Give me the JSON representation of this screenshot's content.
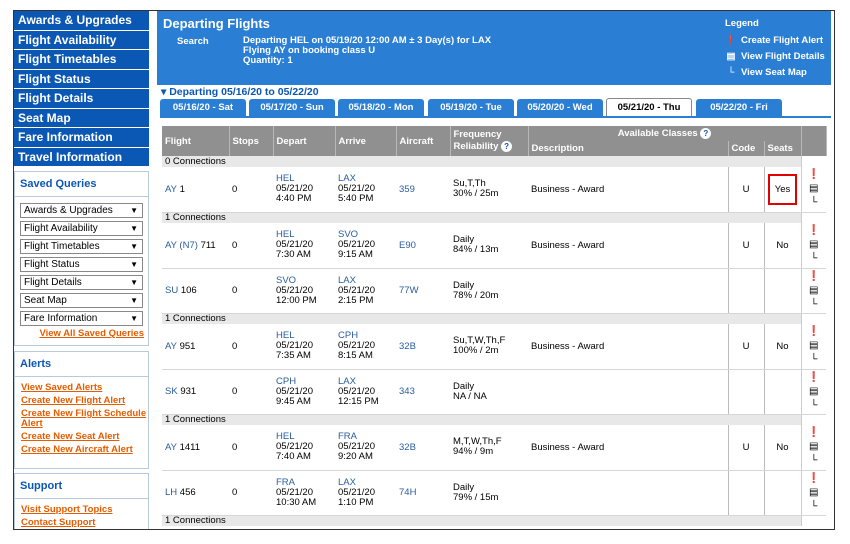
{
  "nav": [
    "Awards & Upgrades",
    "Flight Availability",
    "Flight Timetables",
    "Flight Status",
    "Flight Details",
    "Seat Map",
    "Fare Information",
    "Travel Information"
  ],
  "saved_queries": {
    "title": "Saved Queries",
    "selects": [
      "Awards & Upgrades",
      "Flight Availability",
      "Flight Timetables",
      "Flight Status",
      "Flight Details",
      "Seat Map",
      "Fare Information"
    ],
    "view_all": "View All Saved Queries"
  },
  "alerts": {
    "title": "Alerts",
    "links": [
      "View Saved Alerts",
      "Create New Flight Alert",
      "Create New Flight Schedule Alert",
      "Create New Seat Alert",
      "Create New Aircraft Alert"
    ]
  },
  "support": {
    "title": "Support",
    "links": [
      "Visit Support Topics",
      "Contact Support"
    ]
  },
  "header": {
    "title": "Departing Flights",
    "search_label": "Search",
    "search_lines": [
      "Departing HEL on 05/19/20 12:00 AM ± 3 Day(s) for LAX",
      "Flying AY on booking class U",
      "Quantity: 1"
    ]
  },
  "legend": {
    "title": "Legend",
    "items": [
      "Create Flight Alert",
      "View Flight Details",
      "View Seat Map"
    ]
  },
  "range": "Departing 05/16/20 to 05/22/20",
  "tabs": [
    "05/16/20 - Sat",
    "05/17/20 - Sun",
    "05/18/20 - Mon",
    "05/19/20 - Tue",
    "05/20/20 - Wed",
    "05/21/20 - Thu",
    "05/22/20 - Fri"
  ],
  "active_tab": "05/21/20 - Thu",
  "columns": {
    "flight": "Flight",
    "stops": "Stops",
    "depart": "Depart",
    "arrive": "Arrive",
    "aircraft": "Aircraft",
    "frequency": "Frequency",
    "reliability": "Reliability",
    "available_classes": "Available Classes",
    "description": "Description",
    "code": "Code",
    "seats": "Seats"
  },
  "groups": [
    {
      "label": "0 Connections",
      "flights": [
        {
          "carrier": "AY",
          "carrier_note": "",
          "number": "1",
          "stops": "0",
          "dep_ap": "HEL",
          "dep_date": "05/21/20",
          "dep_time": "4:40 PM",
          "arr_ap": "LAX",
          "arr_date": "05/21/20",
          "arr_time": "5:40 PM",
          "aircraft": "359",
          "freq": "Su,T,Th",
          "rel": "30% / 25m",
          "desc": "Business - Award",
          "code": "U",
          "seats": "Yes",
          "highlight": true
        }
      ]
    },
    {
      "label": "1 Connections",
      "flights": [
        {
          "carrier": "AY",
          "carrier_note": " (N7)",
          "number": "711",
          "stops": "0",
          "dep_ap": "HEL",
          "dep_date": "05/21/20",
          "dep_time": "7:30 AM",
          "arr_ap": "SVO",
          "arr_date": "05/21/20",
          "arr_time": "9:15 AM",
          "aircraft": "E90",
          "freq": "Daily",
          "rel": "84% / 13m",
          "desc": "Business - Award",
          "code": "U",
          "seats": "No",
          "highlight": false
        },
        {
          "carrier": "SU",
          "carrier_note": "",
          "number": "106",
          "stops": "0",
          "dep_ap": "SVO",
          "dep_date": "05/21/20",
          "dep_time": "12:00 PM",
          "arr_ap": "LAX",
          "arr_date": "05/21/20",
          "arr_time": "2:15 PM",
          "aircraft": "77W",
          "freq": "Daily",
          "rel": "78% / 20m",
          "desc": "",
          "code": "",
          "seats": "",
          "highlight": false
        }
      ]
    },
    {
      "label": "1 Connections",
      "flights": [
        {
          "carrier": "AY",
          "carrier_note": "",
          "number": "951",
          "stops": "0",
          "dep_ap": "HEL",
          "dep_date": "05/21/20",
          "dep_time": "7:35 AM",
          "arr_ap": "CPH",
          "arr_date": "05/21/20",
          "arr_time": "8:15 AM",
          "aircraft": "32B",
          "freq": "Su,T,W,Th,F",
          "rel": "100% / 2m",
          "desc": "Business - Award",
          "code": "U",
          "seats": "No",
          "highlight": false
        },
        {
          "carrier": "SK",
          "carrier_note": "",
          "number": "931",
          "stops": "0",
          "dep_ap": "CPH",
          "dep_date": "05/21/20",
          "dep_time": "9:45 AM",
          "arr_ap": "LAX",
          "arr_date": "05/21/20",
          "arr_time": "12:15 PM",
          "aircraft": "343",
          "freq": "Daily",
          "rel": "NA / NA",
          "desc": "",
          "code": "",
          "seats": "",
          "highlight": false
        }
      ]
    },
    {
      "label": "1 Connections",
      "flights": [
        {
          "carrier": "AY",
          "carrier_note": "",
          "number": "1411",
          "stops": "0",
          "dep_ap": "HEL",
          "dep_date": "05/21/20",
          "dep_time": "7:40 AM",
          "arr_ap": "FRA",
          "arr_date": "05/21/20",
          "arr_time": "9:20 AM",
          "aircraft": "32B",
          "freq": "M,T,W,Th,F",
          "rel": "94% / 9m",
          "desc": "Business - Award",
          "code": "U",
          "seats": "No",
          "highlight": false
        },
        {
          "carrier": "LH",
          "carrier_note": "",
          "number": "456",
          "stops": "0",
          "dep_ap": "FRA",
          "dep_date": "05/21/20",
          "dep_time": "10:30 AM",
          "arr_ap": "LAX",
          "arr_date": "05/21/20",
          "arr_time": "1:10 PM",
          "aircraft": "74H",
          "freq": "Daily",
          "rel": "79% / 15m",
          "desc": "",
          "code": "",
          "seats": "",
          "highlight": false
        }
      ]
    },
    {
      "label": "1 Connections",
      "flights": []
    }
  ],
  "colors": {
    "nav_blue": "#0b57b4",
    "header_blue": "#2a7fd5",
    "link_orange": "#e65c00",
    "highlight_red": "#e00000"
  }
}
